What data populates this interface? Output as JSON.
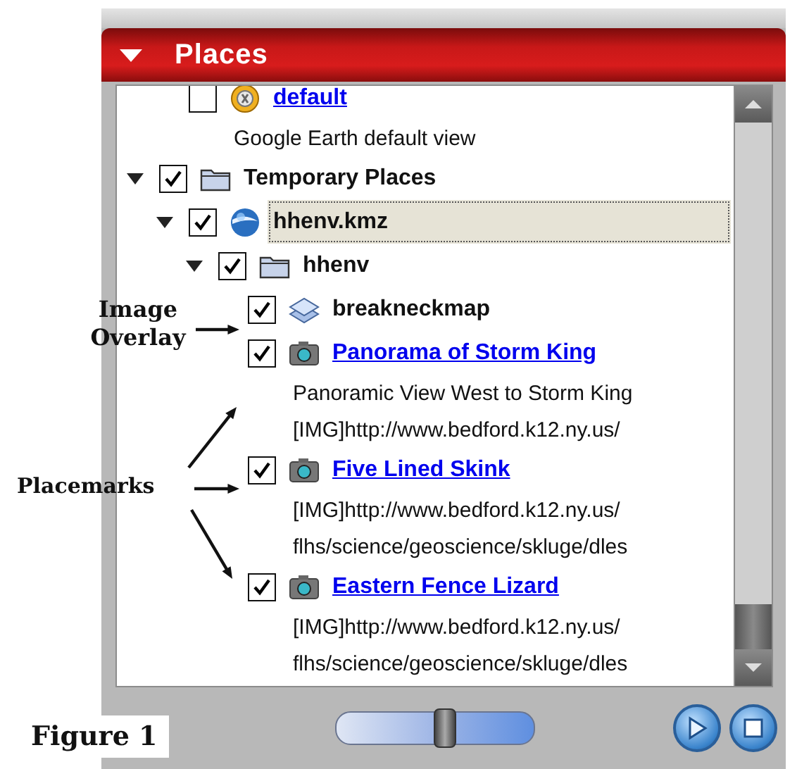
{
  "panel": {
    "title": "Places",
    "expanded": true
  },
  "tree": [
    {
      "children": [
        {
          "kind": "view",
          "label": "default",
          "checked": false,
          "selected": false,
          "description_lines": [
            "Google Earth default view"
          ]
        }
      ]
    },
    {
      "kind": "folder",
      "label": "Temporary Places",
      "checked": true,
      "expanded": true,
      "selected": false,
      "children": [
        {
          "kind": "kmz",
          "label": "hhenv.kmz",
          "checked": true,
          "expanded": true,
          "selected": true,
          "children": [
            {
              "kind": "folder",
              "label": "hhenv",
              "checked": true,
              "expanded": true,
              "selected": false,
              "children": [
                {
                  "kind": "overlay",
                  "label": "breakneckmap",
                  "checked": true,
                  "selected": false
                },
                {
                  "kind": "placemark",
                  "label": "Panorama of Storm King",
                  "checked": true,
                  "selected": false,
                  "description_lines": [
                    "Panoramic View West to Storm King",
                    "[IMG]http://www.bedford.k12.ny.us/"
                  ]
                },
                {
                  "kind": "placemark",
                  "label": "Five Lined Skink",
                  "checked": true,
                  "selected": false,
                  "description_lines": [
                    "[IMG]http://www.bedford.k12.ny.us/",
                    "flhs/science/geoscience/skluge/dles"
                  ]
                },
                {
                  "kind": "placemark",
                  "label": "Eastern Fence Lizard",
                  "checked": true,
                  "selected": false,
                  "description_lines": [
                    "[IMG]http://www.bedford.k12.ny.us/",
                    "flhs/science/geoscience/skluge/dles"
                  ]
                }
              ]
            }
          ]
        }
      ]
    }
  ],
  "controls": {
    "slider": {
      "level": 0.55
    },
    "buttons": [
      {
        "kind": "play"
      },
      {
        "kind": "stop"
      }
    ]
  },
  "annotations": [
    {
      "kind": "image_overlay",
      "text": "Image Overlay"
    },
    {
      "kind": "placemarks",
      "text": "Placemarks"
    }
  ],
  "caption": "Figure 1"
}
